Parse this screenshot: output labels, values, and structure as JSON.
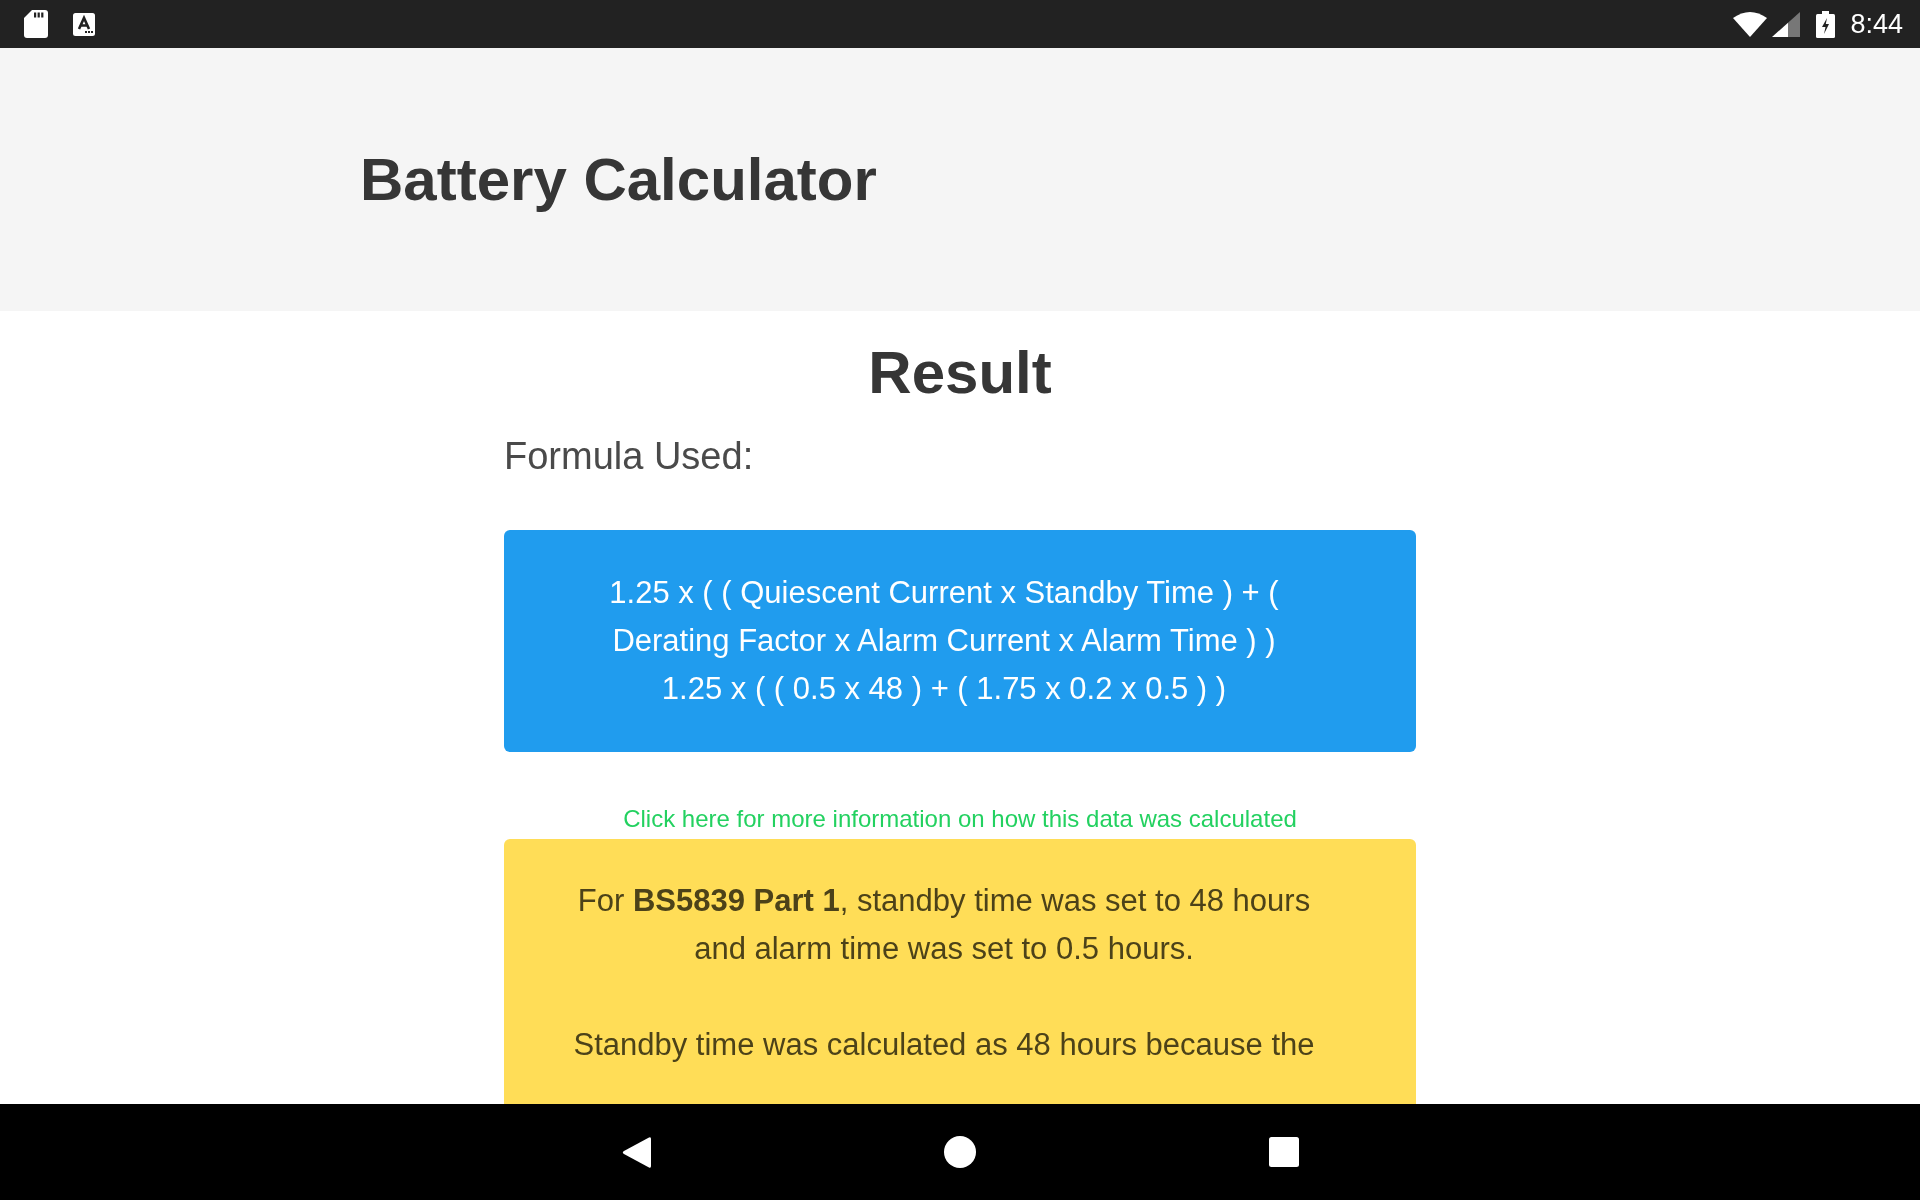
{
  "status_bar": {
    "time": "8:44"
  },
  "header": {
    "title": "Battery Calculator"
  },
  "result": {
    "heading": "Result",
    "formula_label": "Formula Used:",
    "formula_box": {
      "formula": "1.25 x ( ( Quiescent Current x Standby Time ) + ( Derating Factor x Alarm Current x Alarm Time ) )",
      "calculation": "1.25 x ( ( 0.5 x 48 ) + ( 1.75 x 0.2 x 0.5 ) )"
    },
    "info_link": "Click here for more information on how this data was calculated",
    "notice": [
      "For **BS5839 Part 1**, standby time was set to 48 hours and alarm time was set to 0.5 hours.",
      "Standby time was calculated as 48 hours because the"
    ]
  }
}
